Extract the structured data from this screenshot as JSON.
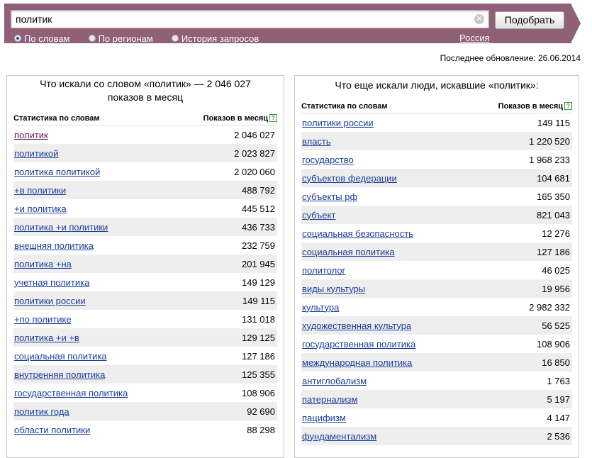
{
  "search": {
    "value": "политик",
    "button_label": "Подобрать"
  },
  "modes": [
    {
      "label": "По словам",
      "selected": true
    },
    {
      "label": "По регионам",
      "selected": false
    },
    {
      "label": "История запросов",
      "selected": false
    }
  ],
  "region": "Россия",
  "last_update": "Последнее обновление: 26.06.2014",
  "left": {
    "title_line1": "Что искали со словом «политик» — 2 046 027",
    "title_line2": "показов в месяц",
    "col_word": "Статистика по словам",
    "col_count": "Показов в месяц",
    "rows": [
      {
        "word": "политик",
        "count": "2 046 027"
      },
      {
        "word": "политикой",
        "count": "2 023 827"
      },
      {
        "word": "политика политикой",
        "count": "2 020 060"
      },
      {
        "word": "+в политики",
        "count": "488 792"
      },
      {
        "word": "+и политика",
        "count": "445 512"
      },
      {
        "word": "политика +и политики",
        "count": "436 733"
      },
      {
        "word": "внешняя политика",
        "count": "232 759"
      },
      {
        "word": "политика +на",
        "count": "201 945"
      },
      {
        "word": "учетная политика",
        "count": "149 129"
      },
      {
        "word": "политики россии",
        "count": "149 115"
      },
      {
        "word": "+по политике",
        "count": "131 018"
      },
      {
        "word": "политика +и +в",
        "count": "129 125"
      },
      {
        "word": "социальная политика",
        "count": "127 186"
      },
      {
        "word": "внутренняя политика",
        "count": "125 355"
      },
      {
        "word": "государственная политика",
        "count": "108 906"
      },
      {
        "word": "политик года",
        "count": "92 690"
      },
      {
        "word": "области политики",
        "count": "88 298"
      }
    ]
  },
  "right": {
    "title": "Что еще искали люди, искавшие «политик»:",
    "col_word": "Статистика по словам",
    "col_count": "Показов в месяц",
    "rows": [
      {
        "word": "политики россии",
        "count": "149 115"
      },
      {
        "word": "власть",
        "count": "1 220 520"
      },
      {
        "word": "государство",
        "count": "1 968 233"
      },
      {
        "word": "субъектов федерации",
        "count": "104 681"
      },
      {
        "word": "субъекты рф",
        "count": "165 350"
      },
      {
        "word": "субъект",
        "count": "821 043"
      },
      {
        "word": "социальная безопасность",
        "count": "12 276"
      },
      {
        "word": "социальная политика",
        "count": "127 186"
      },
      {
        "word": "политолог",
        "count": "46 025"
      },
      {
        "word": "виды культуры",
        "count": "19 956"
      },
      {
        "word": "культура",
        "count": "2 982 332"
      },
      {
        "word": "художественная культура",
        "count": "56 525"
      },
      {
        "word": "государственная политика",
        "count": "108 906"
      },
      {
        "word": "международная политика",
        "count": "16 850"
      },
      {
        "word": "антиглобализм",
        "count": "1 763"
      },
      {
        "word": "патернализм",
        "count": "5 197"
      },
      {
        "word": "пацифизм",
        "count": "4 147"
      },
      {
        "word": "фундаментализм",
        "count": "2 536"
      }
    ]
  },
  "colors": {
    "header": "#8f6078",
    "link": "#1a3d9b",
    "visited_link": "#6b1d5e",
    "row_stripe": "#eeeeee"
  },
  "icons": {
    "clear": "clear-icon",
    "help": "help-icon"
  }
}
